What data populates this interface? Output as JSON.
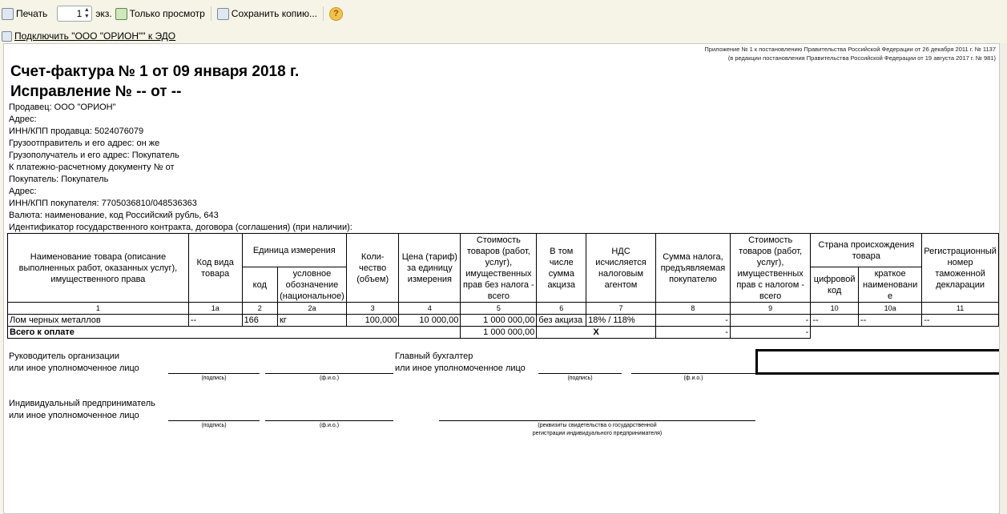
{
  "toolbar": {
    "print": "Печать",
    "copies": "1",
    "copies_unit": "экз.",
    "view_only": "Только просмотр",
    "save_copy": "Сохранить копию...",
    "help": "?"
  },
  "edo_link": "Подключить \"ООО \"ОРИОН\"\" к ЭДО",
  "notes": [
    "Приложение № 1 к постановлению Правительства Российской Федерации от 26 декабря 2011 г. № 1137",
    "(в редакции постановления Правительства Российской Федерации от 19 августа 2017 г. № 981)"
  ],
  "title": "Счет-фактура № 1 от 09 января 2018 г.",
  "correction": "Исправление № -- от --",
  "lines": [
    "Продавец: ООО \"ОРИОН\"",
    "Адрес:",
    "ИНН/КПП продавца: 5024076079",
    "Грузоотправитель и его адрес: он же",
    "Грузополучатель и его адрес: Покупатель",
    "К платежно-расчетному документу №     от",
    "Покупатель: Покупатель",
    "Адрес:",
    "ИНН/КПП покупателя: 7705036810/048536363",
    "Валюта: наименование, код Российский рубль, 643",
    "Идентификатор государственного контракта, договора (соглашения) (при наличии):"
  ],
  "table": {
    "h": {
      "c1": "Наименование товара (описание выполненных работ, оказанных услуг), имущественного права",
      "c1a": "Код вида товара",
      "c2g": "Единица измерения",
      "c2": "код",
      "c2a": "условное обозначение (национальное)",
      "c3": "Коли-чество (объем)",
      "c4": "Цена (тариф) за единицу измерения",
      "c5": "Стоимость товаров (работ, услуг), имущественных прав без налога - всего",
      "c6": "В том числе сумма акциза",
      "c7": "НДС исчисляется налоговым агентом",
      "c8": "Сумма налога, предъявляемая покупателю",
      "c9": "Стоимость товаров (работ, услуг), имущественных прав с налогом - всего",
      "c10g": "Страна происхождения товара",
      "c10": "цифровой код",
      "c10a": "краткое наименовани е",
      "c11": "Регистрационный номер таможенной декларации"
    },
    "nums": [
      "1",
      "1а",
      "2",
      "2а",
      "3",
      "4",
      "5",
      "6",
      "7",
      "8",
      "9",
      "10",
      "10а",
      "11"
    ],
    "row": [
      "Лом черных металлов",
      "--",
      "166",
      "кг",
      "100,000",
      "10 000,00",
      "1 000 000,00",
      "без акциза",
      "18% / 118%",
      "-",
      "-",
      "--",
      "--",
      "--"
    ],
    "total": {
      "label": "Всего к оплате",
      "sum": "1 000 000,00",
      "excise": "X",
      "tax": "-",
      "total": "-"
    }
  },
  "signatures": {
    "head": "Руководитель организации",
    "head2": "или иное уполномоченное лицо",
    "acc": "Главный бухгалтер",
    "acc2": "или иное уполномоченное лицо",
    "ip": "Индивидуальный предприниматель",
    "ip2": "или иное уполномоченное лицо",
    "sign": "(подпись)",
    "fio": "(ф.и.о.)",
    "req1": "(реквизиты свидетельства о государственной",
    "req2": "регистрации индивидуального предпринимателя)"
  }
}
